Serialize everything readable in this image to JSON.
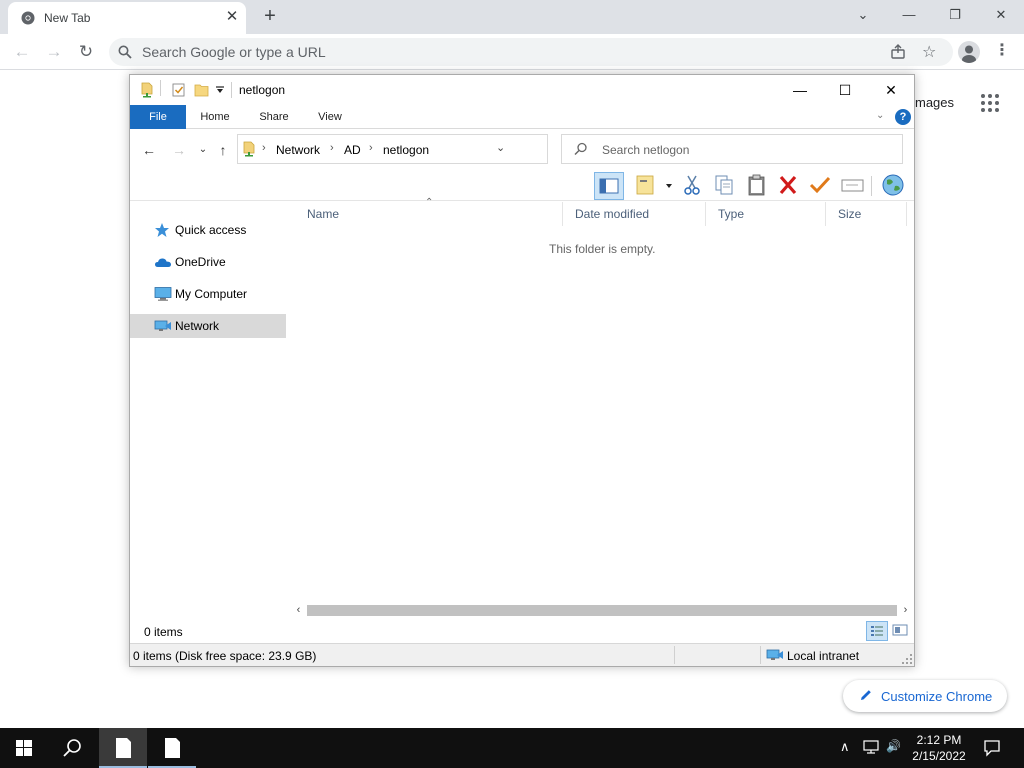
{
  "chrome": {
    "tab_title": "New Tab",
    "tab_close": "✕",
    "new_tab": "+",
    "minimize_tabs": "⌄",
    "window_min": "—",
    "window_restore": "❐",
    "window_close": "✕",
    "omnibox_placeholder": "Search Google or type a URL",
    "menu": "⋮",
    "images_link": "mages",
    "customize_label": "Customize Chrome",
    "back": "←",
    "forward": "→",
    "reload": "↻",
    "star": "☆"
  },
  "explorer": {
    "title": "netlogon",
    "window_min": "—",
    "window_max": "☐",
    "window_close": "✕",
    "ribbon_tabs": [
      "File",
      "Home",
      "Share",
      "View"
    ],
    "ribbon_expand": "⌄",
    "help": "?",
    "breadcrumb": [
      "Network",
      "AD",
      "netlogon"
    ],
    "crumb_sep": "›",
    "addr_dropdown": "⌄",
    "refresh": "↻",
    "nav_back": "←",
    "nav_forward": "→",
    "nav_recent": "⌄",
    "nav_up": "↑",
    "search_placeholder": "Search netlogon",
    "nav_items": [
      "Quick access",
      "OneDrive",
      "My Computer",
      "Network"
    ],
    "selected_nav": "Network",
    "columns": [
      "Name",
      "Date modified",
      "Type",
      "Size"
    ],
    "sort_indicator": "⌃",
    "empty_message": "This folder is empty.",
    "scroll_left": "‹",
    "scroll_right": "›",
    "status_items": "0 items",
    "status_disk": "0 items (Disk free space: 23.9 GB)",
    "status_zone": "Local intranet"
  },
  "taskbar": {
    "time": "2:12 PM",
    "date": "2/15/2022",
    "tray_chevron": "∧",
    "volume": "🔊"
  },
  "colors": {
    "accent": "#1a6cc0",
    "selection": "#cce4f7",
    "taskbar": "#101010"
  }
}
